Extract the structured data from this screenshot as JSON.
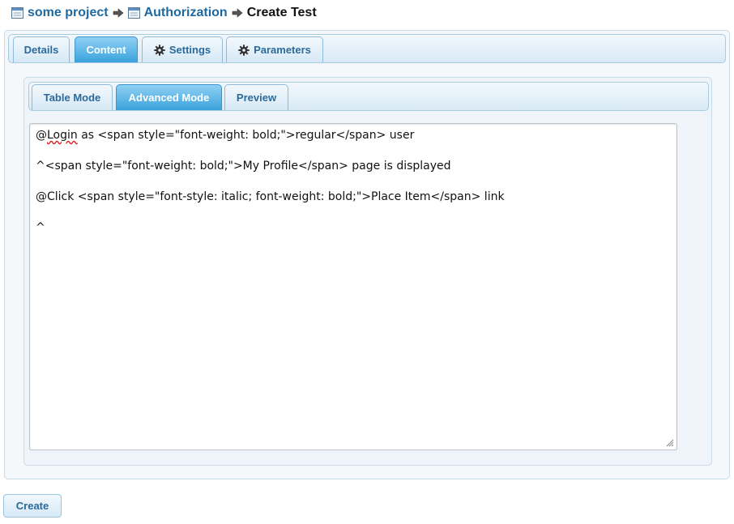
{
  "breadcrumb": {
    "project": "some project",
    "section": "Authorization",
    "current": "Create Test"
  },
  "main_tabs": [
    {
      "label": "Details",
      "icon": null,
      "active": false
    },
    {
      "label": "Content",
      "icon": null,
      "active": true
    },
    {
      "label": "Settings",
      "icon": "gear-icon",
      "active": false
    },
    {
      "label": "Parameters",
      "icon": "gear-icon",
      "active": false
    }
  ],
  "mode_tabs": [
    {
      "label": "Table Mode",
      "active": false
    },
    {
      "label": "Advanced Mode",
      "active": true
    },
    {
      "label": "Preview",
      "active": false
    }
  ],
  "editor": {
    "lines": [
      {
        "misspelled_word": "Login",
        "before": "@",
        "after": " as <span style=\"font-weight: bold;\">regular</span> user"
      },
      {
        "text": "^<span style=\"font-weight: bold;\">My Profile</span> page is displayed"
      },
      {
        "text": "@Click <span style=\"font-style: italic; font-weight: bold;\">Place Item</span> link"
      },
      {
        "text": "^"
      }
    ]
  },
  "actions": {
    "create_label": "Create"
  },
  "colors": {
    "link": "#1e6aa0",
    "active_tab": "#3aa3dd",
    "tab_text": "#2b6a9a"
  }
}
